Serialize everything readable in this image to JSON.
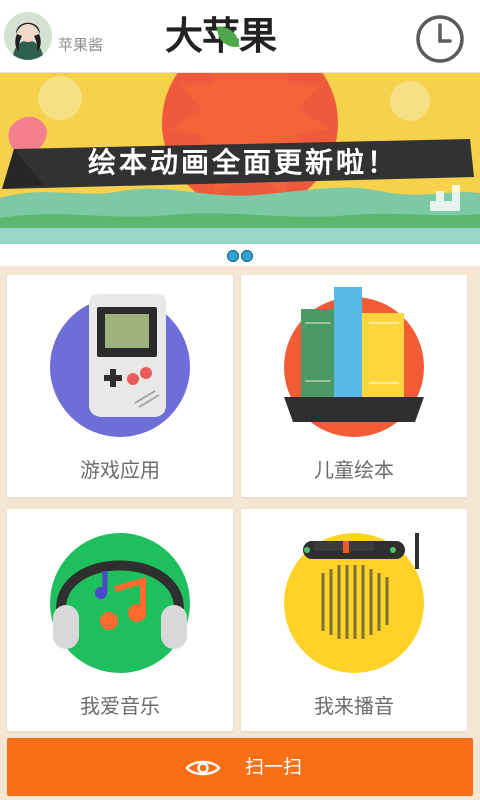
{
  "header": {
    "username": "苹果酱",
    "logo_text": "大苹果",
    "history_icon": "clock-icon",
    "accent": "#4da94a"
  },
  "banner": {
    "headline": "绘本动画全面更新啦！",
    "page_dots": 2
  },
  "cards": [
    {
      "label": "游戏应用",
      "icon": "game-console-icon",
      "color": "#6e6ed8"
    },
    {
      "label": "儿童绘本",
      "icon": "books-icon",
      "color": "#f15b35"
    },
    {
      "label": "我爱音乐",
      "icon": "headphones-icon",
      "color": "#1fbf5e"
    },
    {
      "label": "我来播音",
      "icon": "radio-icon",
      "color": "#ffd227"
    }
  ],
  "scan_button": {
    "label": "扫一扫",
    "icon": "eye-icon",
    "color": "#f76f17"
  }
}
